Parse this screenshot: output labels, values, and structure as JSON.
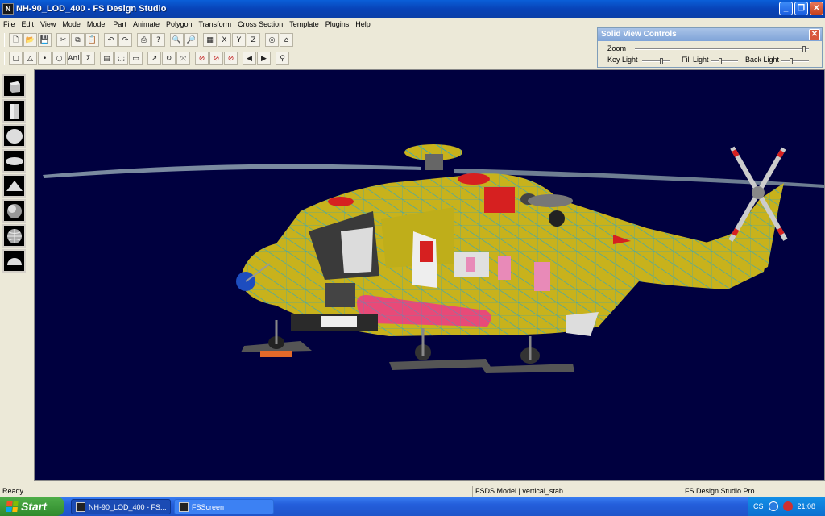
{
  "window": {
    "title": "NH-90_LOD_400 - FS Design Studio",
    "icon_name": "fsds-app-icon",
    "buttons": [
      "minimize",
      "maximize",
      "close"
    ]
  },
  "menu": [
    "File",
    "Edit",
    "View",
    "Mode",
    "Model",
    "Part",
    "Animate",
    "Polygon",
    "Transform",
    "Cross Section",
    "Template",
    "Plugins",
    "Help"
  ],
  "toolbar_row1": [
    {
      "name": "new-file",
      "glyph": "🗋"
    },
    {
      "name": "open-folder",
      "glyph": "📂"
    },
    {
      "name": "save",
      "glyph": "💾"
    },
    {
      "name": "cut",
      "glyph": "✂"
    },
    {
      "name": "copy",
      "glyph": "⧉"
    },
    {
      "name": "paste",
      "glyph": "📋"
    },
    {
      "name": "undo",
      "glyph": "↶"
    },
    {
      "name": "redo",
      "glyph": "↷"
    },
    {
      "name": "print",
      "glyph": "⎙"
    },
    {
      "name": "help",
      "glyph": "?"
    },
    {
      "name": "zoom-in",
      "glyph": "🔍"
    },
    {
      "name": "zoom-out",
      "glyph": "🔎"
    },
    {
      "name": "grid",
      "glyph": "▦"
    },
    {
      "name": "axis-x",
      "glyph": "X"
    },
    {
      "name": "axis-y",
      "glyph": "Y"
    },
    {
      "name": "axis-z",
      "glyph": "Z"
    },
    {
      "name": "view-3d",
      "glyph": "◎"
    },
    {
      "name": "home",
      "glyph": "⌂"
    }
  ],
  "toolbar_row2": [
    {
      "name": "select-part",
      "glyph": "▢"
    },
    {
      "name": "triangle",
      "glyph": "△"
    },
    {
      "name": "point",
      "glyph": "•"
    },
    {
      "name": "circle",
      "glyph": "○"
    },
    {
      "name": "animate",
      "glyph": "Ani"
    },
    {
      "name": "sigma",
      "glyph": "Σ"
    },
    {
      "name": "texture",
      "glyph": "▤"
    },
    {
      "name": "marquee",
      "glyph": "⬚"
    },
    {
      "name": "ruler",
      "glyph": "▭"
    },
    {
      "name": "move",
      "glyph": "↗"
    },
    {
      "name": "rotate",
      "glyph": "↻"
    },
    {
      "name": "scale",
      "glyph": "⤧"
    },
    {
      "name": "no-move",
      "glyph": "⊘"
    },
    {
      "name": "no-rotate",
      "glyph": "⊘"
    },
    {
      "name": "no-scale",
      "glyph": "⊘"
    },
    {
      "name": "prev",
      "glyph": "◀"
    },
    {
      "name": "next",
      "glyph": "▶"
    },
    {
      "name": "find",
      "glyph": "⚲"
    }
  ],
  "solid_view_controls": {
    "title": "Solid View Controls",
    "zoom_label": "Zoom",
    "key_light_label": "Key Light",
    "fill_light_label": "Fill Light",
    "back_light_label": "Back Light"
  },
  "shape_palette": [
    "cube",
    "cylinder",
    "sphere",
    "ellipsoid",
    "cone",
    "sphere-shaded",
    "sphere-wire",
    "hemisphere"
  ],
  "status": {
    "ready": "Ready",
    "model": "FSDS Model | vertical_stab",
    "product": "FS Design Studio Pro"
  },
  "taskbar": {
    "start": "Start",
    "tasks": [
      "NH-90_LOD_400 - FS...",
      "FSScreen"
    ],
    "tray_lang": "CS",
    "clock": "21:08"
  },
  "colors": {
    "viewport_bg": "#00003f",
    "fuselage": "#c8b21c",
    "wire": "#2aa6c8",
    "accent_red": "#d62020"
  }
}
